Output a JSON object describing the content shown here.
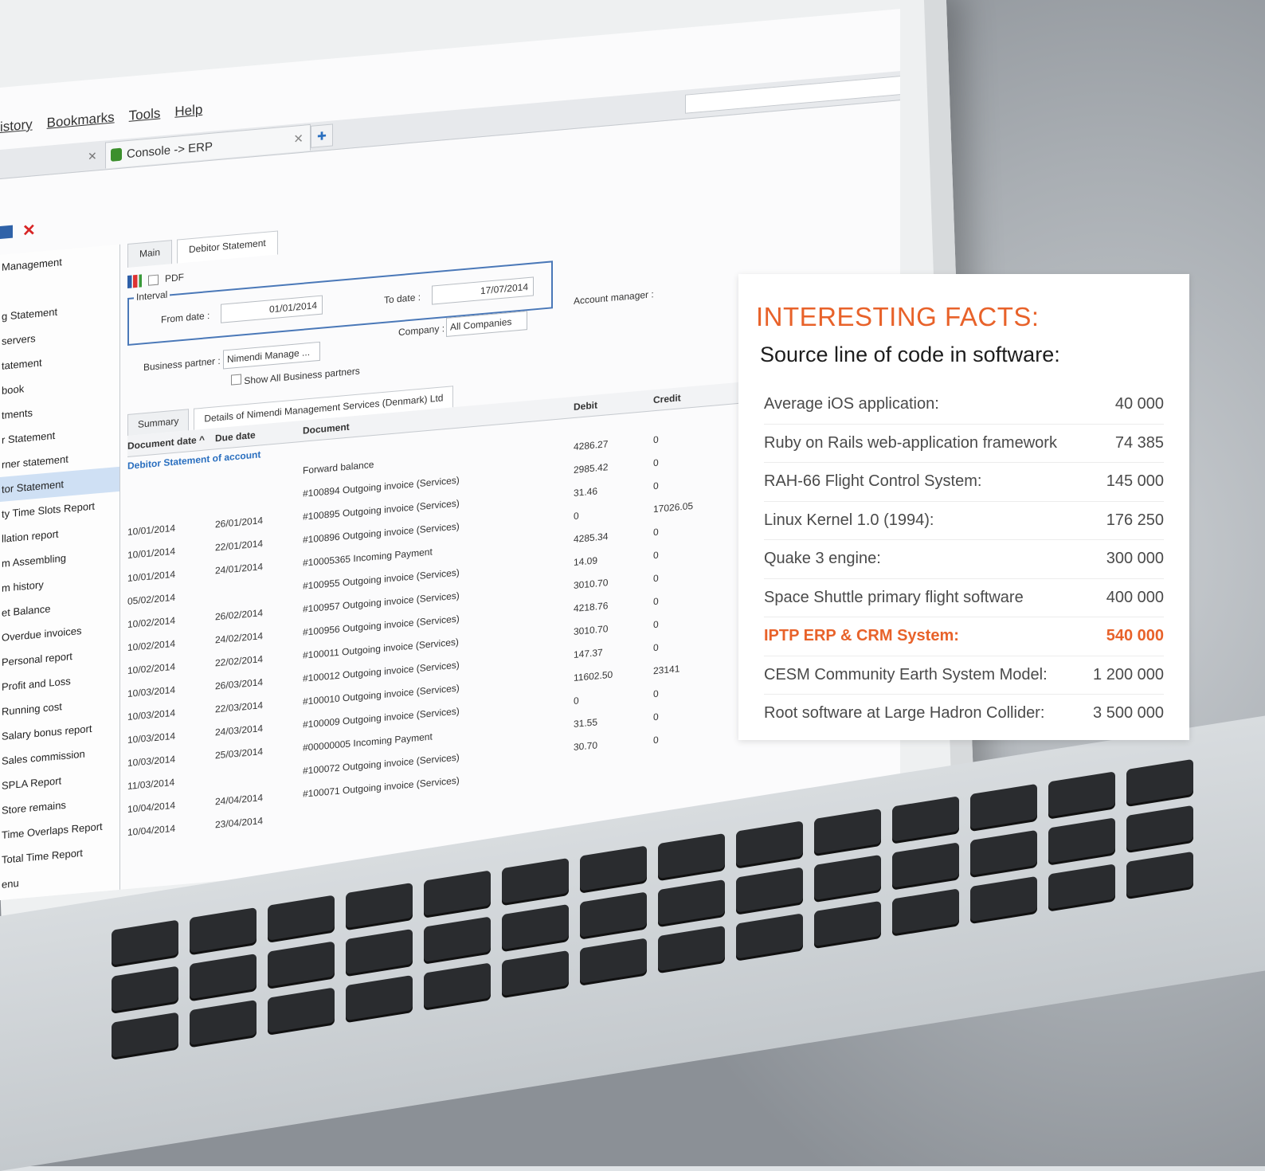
{
  "browser": {
    "menu": [
      "istory",
      "Bookmarks",
      "Tools",
      "Help"
    ],
    "tab_title": "Console -> ERP"
  },
  "sidebar": {
    "items": [
      "Management",
      "",
      "g Statement",
      "servers",
      "tatement",
      "book",
      "tments",
      "r Statement",
      "rner statement",
      "tor Statement",
      "ty Time Slots Report",
      "llation report",
      "m Assembling",
      "m history",
      "et Balance",
      "Overdue invoices",
      "Personal report",
      "Profit and Loss",
      "Running cost",
      "Salary bonus report",
      "Sales commission",
      "SPLA Report",
      "Store remains",
      "Time Overlaps Report",
      "Total Time Report"
    ],
    "footer": "enu"
  },
  "main": {
    "tabs": [
      "Main",
      "Debitor Statement"
    ],
    "pdf_label": "PDF",
    "interval_label": "Interval",
    "from_label": "From date :",
    "from_value": "01/01/2014",
    "to_label": "To date :",
    "to_value": "17/07/2014",
    "company_label": "Company :",
    "company_value": "All Companies",
    "account_manager_label": "Account manager :",
    "bp_label": "Business partner :",
    "bp_value": "Nimendi Manage ...",
    "show_all_label": "Show All Business partners"
  },
  "grid": {
    "tabs": [
      "Summary",
      "Details of Nimendi Management Services (Denmark) Ltd"
    ],
    "headers": [
      "Document date ^",
      "Due date",
      "Document",
      "Debit",
      "Credit"
    ],
    "group": "Debitor Statement of account",
    "rows": [
      [
        "",
        "",
        "Forward balance",
        "4286.27",
        "0"
      ],
      [
        "",
        "",
        "#100894 Outgoing invoice (Services)",
        "2985.42",
        "0"
      ],
      [
        "10/01/2014",
        "26/01/2014",
        "#100895 Outgoing invoice (Services)",
        "31.46",
        "0"
      ],
      [
        "10/01/2014",
        "22/01/2014",
        "#100896 Outgoing invoice (Services)",
        "0",
        "17026.05"
      ],
      [
        "10/01/2014",
        "24/01/2014",
        "#10005365 Incoming Payment",
        "4285.34",
        "0"
      ],
      [
        "05/02/2014",
        "",
        "#100955 Outgoing invoice (Services)",
        "14.09",
        "0"
      ],
      [
        "10/02/2014",
        "26/02/2014",
        "#100957 Outgoing invoice (Services)",
        "3010.70",
        "0"
      ],
      [
        "10/02/2014",
        "24/02/2014",
        "#100956 Outgoing invoice (Services)",
        "4218.76",
        "0"
      ],
      [
        "10/02/2014",
        "22/02/2014",
        "#100011 Outgoing invoice (Services)",
        "3010.70",
        "0"
      ],
      [
        "10/03/2014",
        "26/03/2014",
        "#100012 Outgoing invoice (Services)",
        "147.37",
        "0"
      ],
      [
        "10/03/2014",
        "22/03/2014",
        "#100010 Outgoing invoice (Services)",
        "11602.50",
        "23141"
      ],
      [
        "10/03/2014",
        "24/03/2014",
        "#100009 Outgoing invoice (Services)",
        "0",
        "0"
      ],
      [
        "10/03/2014",
        "25/03/2014",
        "#00000005 Incoming Payment",
        "31.55",
        "0"
      ],
      [
        "11/03/2014",
        "",
        "#100072 Outgoing invoice (Services)",
        "30.70",
        "0"
      ],
      [
        "10/04/2014",
        "24/04/2014",
        "#100071 Outgoing invoice (Services)",
        "",
        ""
      ],
      [
        "10/04/2014",
        "23/04/2014",
        "",
        "",
        ""
      ]
    ]
  },
  "facts": {
    "title": "INTERESTING FACTS:",
    "subtitle": "Source line of code in software:",
    "items": [
      {
        "label": "Average iOS application:",
        "value": "40 000"
      },
      {
        "label": "Ruby on Rails web-application framework",
        "value": "74 385"
      },
      {
        "label": "RAH-66 Flight Control System:",
        "value": "145 000"
      },
      {
        "label": "Linux Kernel 1.0 (1994):",
        "value": "176 250"
      },
      {
        "label": "Quake 3 engine:",
        "value": "300 000"
      },
      {
        "label": "Space Shuttle primary flight software",
        "value": "400 000"
      },
      {
        "label": "IPTP ERP & CRM System:",
        "value": "540 000"
      },
      {
        "label": "CESM Community Earth System Model:",
        "value": "1 200 000"
      },
      {
        "label": "Root software at Large Hadron Collider:",
        "value": "3 500 000"
      }
    ],
    "highlight_color": "#e8622a"
  }
}
